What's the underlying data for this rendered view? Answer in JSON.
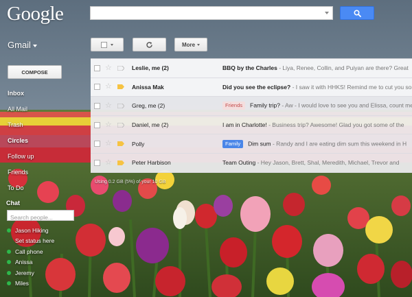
{
  "app": {
    "logo": "Google",
    "product": "Gmail"
  },
  "search": {
    "value": "",
    "placeholder": ""
  },
  "toolbar": {
    "more_label": "More"
  },
  "sidebar": {
    "compose_label": "COMPOSE",
    "items": [
      {
        "label": "Inbox",
        "bold": true
      },
      {
        "label": "All Mail",
        "bold": false
      },
      {
        "label": "Trash",
        "bold": false
      },
      {
        "label": "Circles",
        "bold": true
      },
      {
        "label": "Follow up",
        "bold": false
      },
      {
        "label": "Friends",
        "bold": false
      },
      {
        "label": "To Do",
        "bold": false
      }
    ]
  },
  "chat": {
    "title": "Chat",
    "search_placeholder": "Search people...",
    "contacts": [
      {
        "name": "Jason Hiking",
        "online": true
      },
      {
        "name": "Set status here",
        "online": false
      },
      {
        "name": "Call phone",
        "online": true
      },
      {
        "name": "Anissa",
        "online": true
      },
      {
        "name": "Jeremy",
        "online": true
      },
      {
        "name": "Miles",
        "online": true
      }
    ]
  },
  "messages": [
    {
      "sender": "Leslie, me (2)",
      "important": false,
      "label": "",
      "subject": "BBQ by the Charles",
      "snippet": " - Liya, Renee, Collin, and Puiyan are there? Great"
    },
    {
      "sender": "Anissa Mak",
      "important": true,
      "label": "",
      "subject": "Did you see the eclipse?",
      "snippet": " - I saw it with HHKS! Remind me to cut you some"
    },
    {
      "sender": "Greg, me (2)",
      "important": false,
      "label": "Friends",
      "subject": "Family trip?",
      "snippet": " - Aw - I would love to see you and Elissa, count me in"
    },
    {
      "sender": "Daniel, me (2)",
      "important": false,
      "label": "",
      "subject": "I am in Charlotte!",
      "snippet": " - Business trip? Awesome! Glad you got some of the"
    },
    {
      "sender": "Polly",
      "important": true,
      "label": "Family",
      "subject": "Dim sum",
      "snippet": " - Randy and I are eating dim sum this weekend in H"
    },
    {
      "sender": "Peter Harbison",
      "important": true,
      "label": "",
      "subject": "Team Outing",
      "snippet": " - Hey Jason, Brett, Shal, Meredith, Michael, Trevor and"
    }
  ],
  "footer": {
    "text": "Using 0.2 GB (5%) of your 10 GB"
  },
  "colors": {
    "search_button": "#4a8af4",
    "online_dot": "#2db84b",
    "important_marker": "#f6c343",
    "friends_label_bg": "#f4dede",
    "family_label_bg": "#4a86e8"
  },
  "icons": {
    "search_button": "search-icon",
    "refresh_button": "refresh-icon",
    "star": "star-icon",
    "important": "importance-marker-icon",
    "presence": "online-dot-icon"
  }
}
